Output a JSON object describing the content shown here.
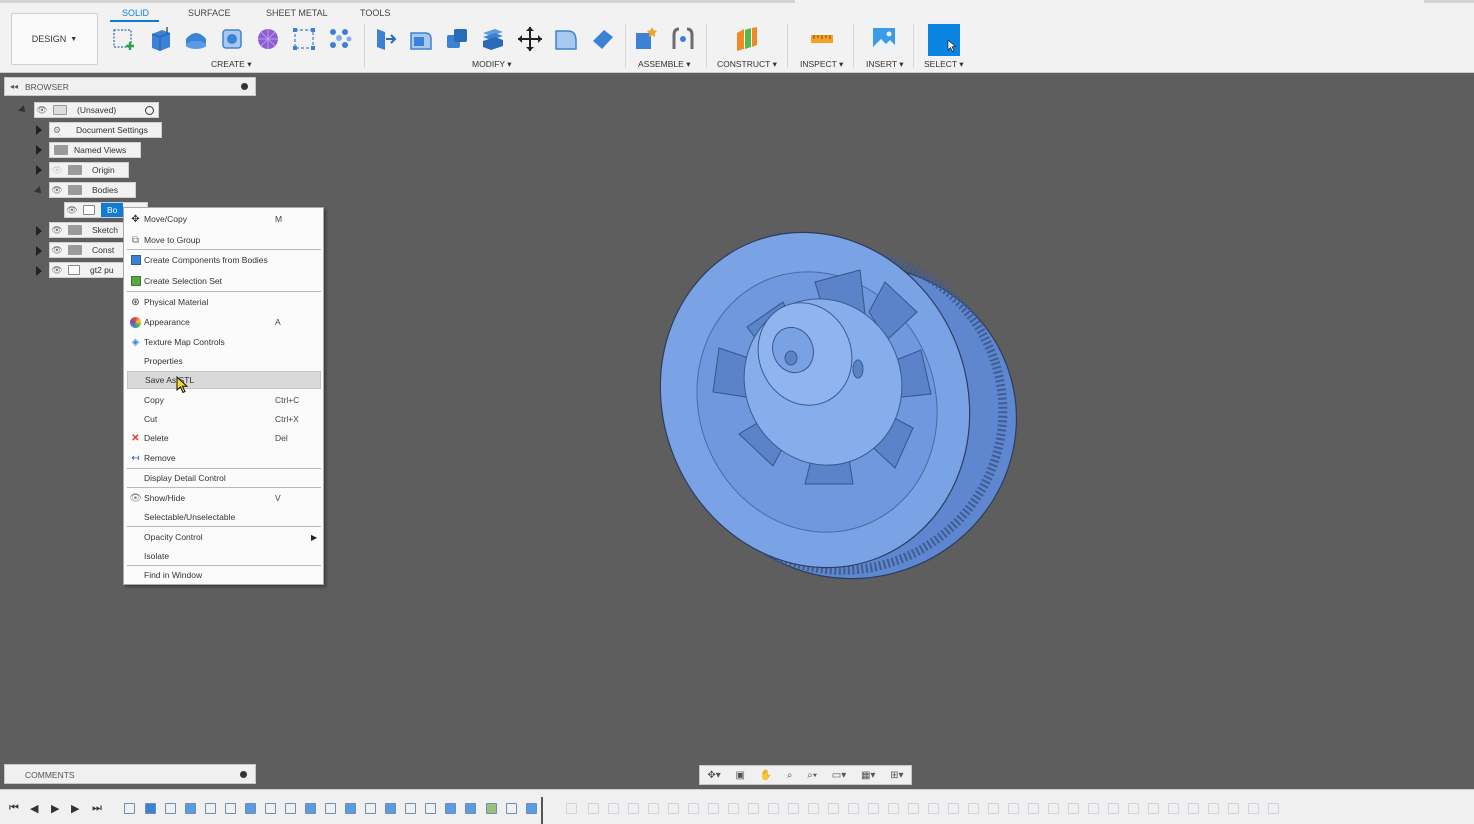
{
  "toolbar": {
    "design_label": "DESIGN",
    "tabs": [
      {
        "label": "SOLID",
        "active": true
      },
      {
        "label": "SURFACE",
        "active": false
      },
      {
        "label": "SHEET METAL",
        "active": false
      },
      {
        "label": "TOOLS",
        "active": false
      }
    ],
    "groups": {
      "create": "CREATE",
      "modify": "MODIFY",
      "assemble": "ASSEMBLE",
      "construct": "CONSTRUCT",
      "inspect": "INSPECT",
      "insert": "INSERT",
      "select": "SELECT"
    },
    "accent_color": "#0f7bd6"
  },
  "browser": {
    "title": "BROWSER",
    "root": "(Unsaved)",
    "nodes": {
      "document_settings": "Document Settings",
      "named_views": "Named Views",
      "origin": "Origin",
      "bodies": "Bodies",
      "body_selected": "Bo",
      "sketches": "Sketch",
      "construction": "Const",
      "component": "gt2 pu"
    }
  },
  "context_menu": {
    "items": [
      {
        "label": "Move/Copy",
        "shortcut": "M",
        "icon": "move-icon"
      },
      {
        "label": "Move to Group",
        "shortcut": "",
        "icon": "move-to-group-icon"
      },
      {
        "label": "Create Components from Bodies",
        "shortcut": "",
        "icon": "components-icon"
      },
      {
        "label": "Create Selection Set",
        "shortcut": "",
        "icon": "selection-set-icon"
      },
      {
        "label": "Physical Material",
        "shortcut": "",
        "icon": "material-icon"
      },
      {
        "label": "Appearance",
        "shortcut": "A",
        "icon": "appearance-icon"
      },
      {
        "label": "Texture Map Controls",
        "shortcut": "",
        "icon": "texture-icon"
      },
      {
        "label": "Properties",
        "shortcut": "",
        "icon": ""
      },
      {
        "label": "Save As STL",
        "shortcut": "",
        "icon": ""
      },
      {
        "label": "Copy",
        "shortcut": "Ctrl+C",
        "icon": ""
      },
      {
        "label": "Cut",
        "shortcut": "Ctrl+X",
        "icon": ""
      },
      {
        "label": "Delete",
        "shortcut": "Del",
        "icon": "delete-icon"
      },
      {
        "label": "Remove",
        "shortcut": "",
        "icon": "remove-icon"
      },
      {
        "label": "Display Detail Control",
        "shortcut": "",
        "icon": ""
      },
      {
        "label": "Show/Hide",
        "shortcut": "V",
        "icon": "eye-icon"
      },
      {
        "label": "Selectable/Unselectable",
        "shortcut": "",
        "icon": ""
      },
      {
        "label": "Opacity Control",
        "shortcut": "",
        "icon": "submenu-arrow-icon"
      },
      {
        "label": "Isolate",
        "shortcut": "",
        "icon": ""
      },
      {
        "label": "Find in Window",
        "shortcut": "",
        "icon": ""
      }
    ],
    "highlighted_index": 8
  },
  "comments": {
    "title": "COMMENTS"
  },
  "model": {
    "color": "#6f98de"
  }
}
